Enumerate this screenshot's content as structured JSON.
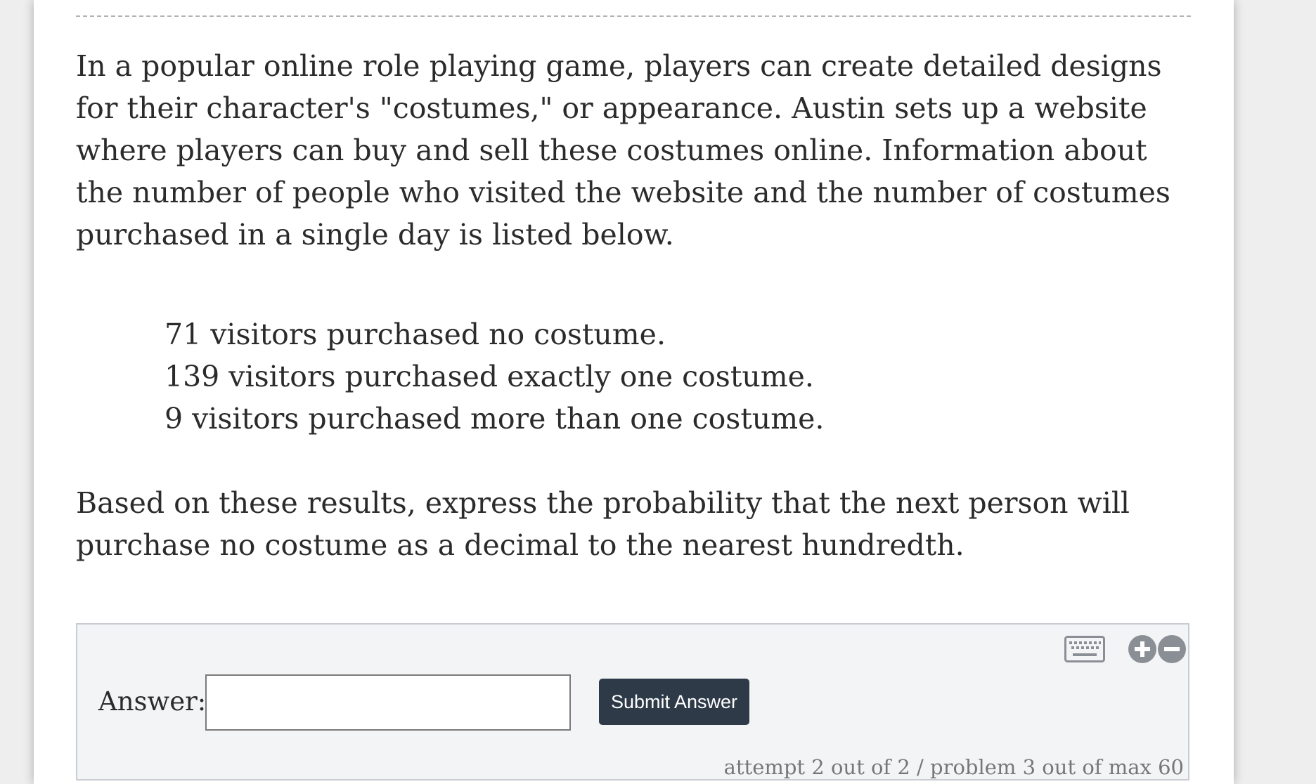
{
  "question": {
    "paragraph": "In a popular online role playing game, players can create detailed designs for their character's \"costumes,\" or appearance. Austin sets up a website where players can buy and sell these costumes online. Information about the number of people who visited the website and the number of costumes purchased in a single day is listed below.",
    "data_lines": [
      "71 visitors purchased no costume.",
      "139 visitors purchased exactly one costume.",
      "9 visitors purchased more than one costume."
    ],
    "prompt": "Based on these results, express the probability that the next person will purchase no costume as a decimal to the nearest hundredth."
  },
  "answer_panel": {
    "label": "Answer:",
    "input_value": "",
    "input_placeholder": "",
    "submit_label": "Submit Answer",
    "attempt_status": "attempt 2 out of 2 / problem 3 out of max 60",
    "icons": [
      "keyboard-icon",
      "zoom-in-icon",
      "zoom-out-icon"
    ]
  },
  "colors": {
    "button_bg": "#2e3a48",
    "panel_bg": "#f3f4f6",
    "icon_gray": "#8a8f96"
  }
}
